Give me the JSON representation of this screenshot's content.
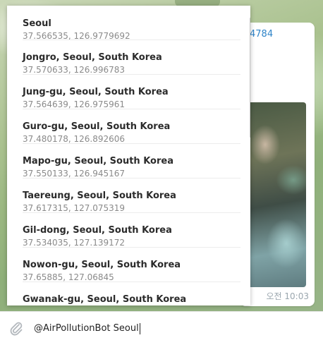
{
  "bubble": {
    "link_fragment": "4784",
    "time": "오전 10:03"
  },
  "dropdown": {
    "results": [
      {
        "title": "Seoul",
        "coords": "37.566535, 126.9779692"
      },
      {
        "title": "Jongro, Seoul, South Korea",
        "coords": "37.570633, 126.996783"
      },
      {
        "title": "Jung-gu, Seoul, South Korea",
        "coords": "37.564639, 126.975961"
      },
      {
        "title": "Guro-gu, Seoul, South Korea",
        "coords": "37.480178, 126.892606"
      },
      {
        "title": "Mapo-gu, Seoul, South Korea",
        "coords": "37.550133, 126.945167"
      },
      {
        "title": "Taereung, Seoul, South Korea",
        "coords": "37.617315, 127.075319"
      },
      {
        "title": "Gil-dong, Seoul, South Korea",
        "coords": "37.534035, 127.139172"
      },
      {
        "title": "Nowon-gu, Seoul, South Korea",
        "coords": "37.65885, 127.06845"
      },
      {
        "title": "Gwanak-gu, Seoul, South Korea",
        "coords": ""
      }
    ]
  },
  "composer": {
    "input_value": "@AirPollutionBot Seoul",
    "attach_icon": "paperclip-icon"
  },
  "colors": {
    "link": "#2f84c8",
    "title_text": "#2b2b2b",
    "secondary_text": "#8a8a8a"
  }
}
